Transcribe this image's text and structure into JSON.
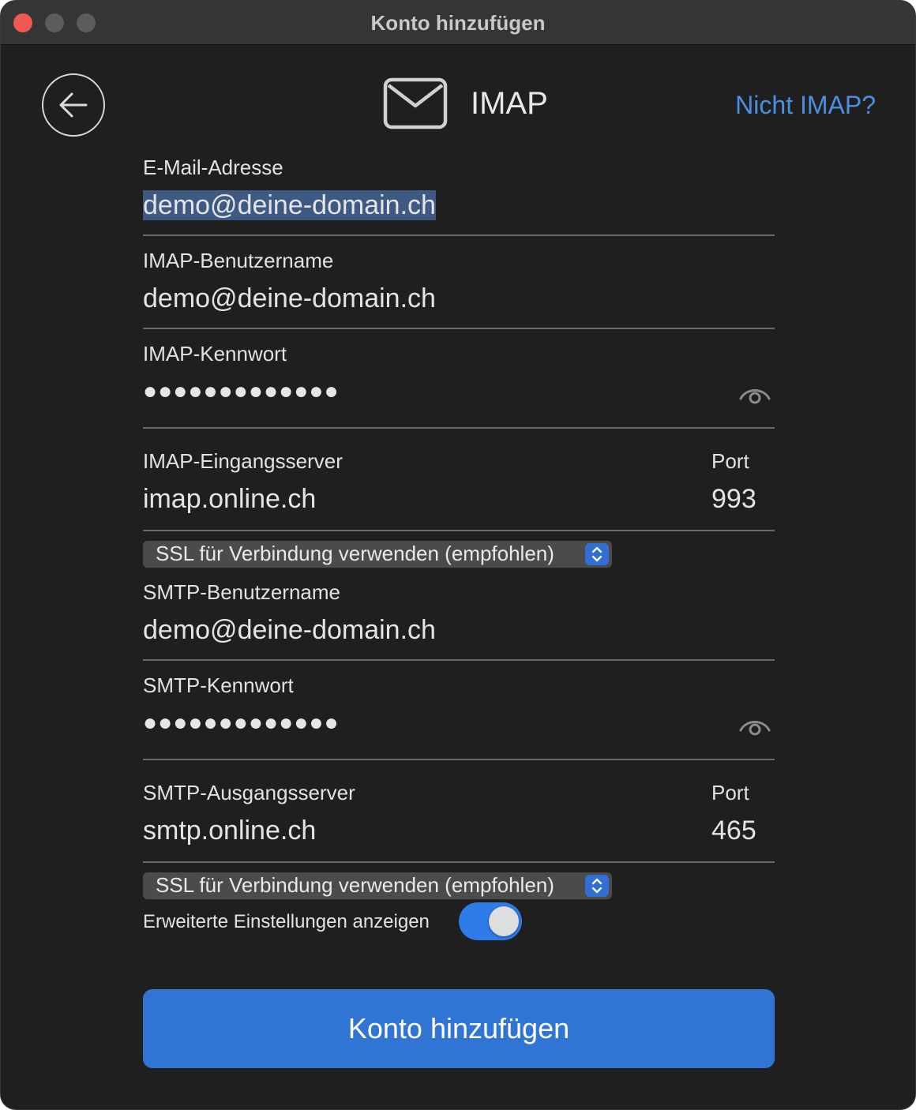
{
  "window": {
    "title": "Konto hinzufügen"
  },
  "header": {
    "provider": "IMAP",
    "alt_link": "Nicht IMAP?"
  },
  "fields": {
    "email": {
      "label": "E-Mail-Adresse",
      "value": "demo@deine-domain.ch"
    },
    "imap_user": {
      "label": "IMAP-Benutzername",
      "value": "demo@deine-domain.ch"
    },
    "imap_password": {
      "label": "IMAP-Kennwort",
      "masked": "●●●●●●●●●●●●●"
    },
    "imap_server": {
      "label": "IMAP-Eingangsserver",
      "value": "imap.online.ch",
      "port_label": "Port",
      "port": "993"
    },
    "imap_ssl": {
      "selected": "SSL für Verbindung verwenden (empfohlen)"
    },
    "smtp_user": {
      "label": "SMTP-Benutzername",
      "value": "demo@deine-domain.ch"
    },
    "smtp_password": {
      "label": "SMTP-Kennwort",
      "masked": "●●●●●●●●●●●●●"
    },
    "smtp_server": {
      "label": "SMTP-Ausgangsserver",
      "value": "smtp.online.ch",
      "port_label": "Port",
      "port": "465"
    },
    "smtp_ssl": {
      "selected": "SSL für Verbindung verwenden (empfohlen)"
    },
    "advanced": {
      "label": "Erweiterte Einstellungen anzeigen",
      "on": true
    }
  },
  "actions": {
    "submit": "Konto hinzufügen"
  },
  "colors": {
    "accent": "#3175d4",
    "link": "#4a90e2",
    "background": "#1f1f1f"
  }
}
